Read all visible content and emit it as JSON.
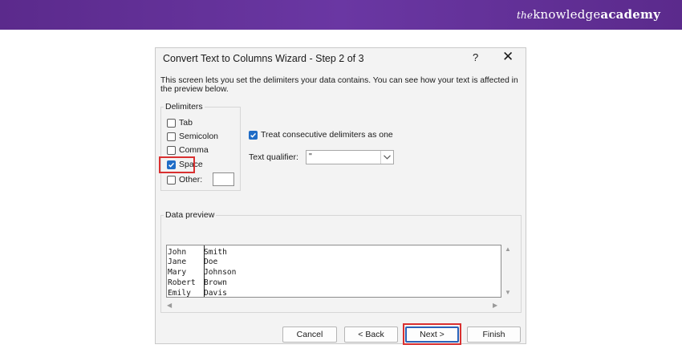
{
  "brand": {
    "the": "the",
    "knowledge": "knowledge",
    "academy": "academy"
  },
  "dialog": {
    "title": "Convert Text to Columns Wizard - Step 2 of 3",
    "help": "?",
    "close": "✕",
    "description": "This screen lets you set the delimiters your data contains.  You can see how your text is affected in the preview below."
  },
  "delimiters": {
    "group_label": "Delimiters",
    "items": [
      {
        "label": "Tab",
        "checked": false
      },
      {
        "label": "Semicolon",
        "checked": false
      },
      {
        "label": "Comma",
        "checked": false
      },
      {
        "label": "Space",
        "checked": true
      },
      {
        "label": "Other:",
        "checked": false
      }
    ],
    "other_value": ""
  },
  "options": {
    "consecutive_label": "Treat consecutive delimiters as one",
    "consecutive_checked": true,
    "text_qualifier_label": "Text qualifier:",
    "text_qualifier_value": "\""
  },
  "preview": {
    "group_label": "Data preview",
    "rows": [
      [
        "John",
        "Smith"
      ],
      [
        "Jane",
        "Doe"
      ],
      [
        "Mary",
        "Johnson"
      ],
      [
        "Robert",
        "Brown"
      ],
      [
        "Emily",
        "Davis"
      ]
    ]
  },
  "buttons": {
    "cancel": "Cancel",
    "back": "< Back",
    "next": "Next >",
    "finish": "Finish"
  },
  "colors": {
    "accent": "#1f6cc6",
    "highlight": "#d93030",
    "brand_bar": "#5b2a8c"
  }
}
